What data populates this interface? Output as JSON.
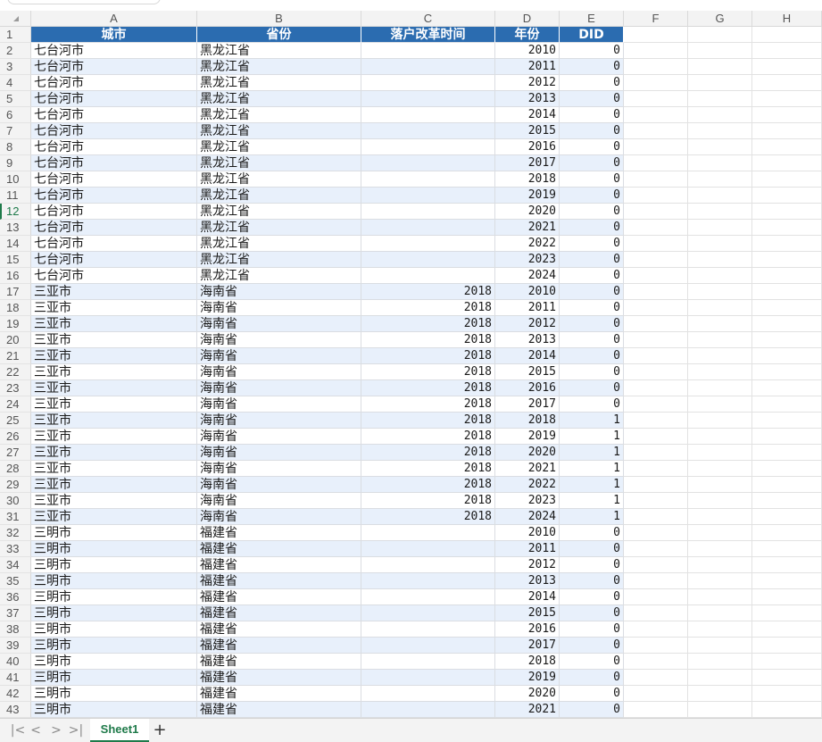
{
  "colors": {
    "header_fill": "#2b6cb0",
    "band_fill": "#e8f0fb",
    "active_accent": "#1f7a4a"
  },
  "column_letters": [
    "A",
    "B",
    "C",
    "D",
    "E",
    "F",
    "G",
    "H"
  ],
  "header_row": [
    "城市",
    "省份",
    "落户改革时间",
    "年份",
    "DID"
  ],
  "rows": [
    {
      "r": 2,
      "city": "七台河市",
      "prov": "黑龙江省",
      "reform": "",
      "year": "2010",
      "did": "0"
    },
    {
      "r": 3,
      "city": "七台河市",
      "prov": "黑龙江省",
      "reform": "",
      "year": "2011",
      "did": "0"
    },
    {
      "r": 4,
      "city": "七台河市",
      "prov": "黑龙江省",
      "reform": "",
      "year": "2012",
      "did": "0"
    },
    {
      "r": 5,
      "city": "七台河市",
      "prov": "黑龙江省",
      "reform": "",
      "year": "2013",
      "did": "0"
    },
    {
      "r": 6,
      "city": "七台河市",
      "prov": "黑龙江省",
      "reform": "",
      "year": "2014",
      "did": "0"
    },
    {
      "r": 7,
      "city": "七台河市",
      "prov": "黑龙江省",
      "reform": "",
      "year": "2015",
      "did": "0"
    },
    {
      "r": 8,
      "city": "七台河市",
      "prov": "黑龙江省",
      "reform": "",
      "year": "2016",
      "did": "0"
    },
    {
      "r": 9,
      "city": "七台河市",
      "prov": "黑龙江省",
      "reform": "",
      "year": "2017",
      "did": "0"
    },
    {
      "r": 10,
      "city": "七台河市",
      "prov": "黑龙江省",
      "reform": "",
      "year": "2018",
      "did": "0"
    },
    {
      "r": 11,
      "city": "七台河市",
      "prov": "黑龙江省",
      "reform": "",
      "year": "2019",
      "did": "0"
    },
    {
      "r": 12,
      "city": "七台河市",
      "prov": "黑龙江省",
      "reform": "",
      "year": "2020",
      "did": "0"
    },
    {
      "r": 13,
      "city": "七台河市",
      "prov": "黑龙江省",
      "reform": "",
      "year": "2021",
      "did": "0"
    },
    {
      "r": 14,
      "city": "七台河市",
      "prov": "黑龙江省",
      "reform": "",
      "year": "2022",
      "did": "0"
    },
    {
      "r": 15,
      "city": "七台河市",
      "prov": "黑龙江省",
      "reform": "",
      "year": "2023",
      "did": "0"
    },
    {
      "r": 16,
      "city": "七台河市",
      "prov": "黑龙江省",
      "reform": "",
      "year": "2024",
      "did": "0"
    },
    {
      "r": 17,
      "city": "三亚市",
      "prov": "海南省",
      "reform": "2018",
      "year": "2010",
      "did": "0"
    },
    {
      "r": 18,
      "city": "三亚市",
      "prov": "海南省",
      "reform": "2018",
      "year": "2011",
      "did": "0"
    },
    {
      "r": 19,
      "city": "三亚市",
      "prov": "海南省",
      "reform": "2018",
      "year": "2012",
      "did": "0"
    },
    {
      "r": 20,
      "city": "三亚市",
      "prov": "海南省",
      "reform": "2018",
      "year": "2013",
      "did": "0"
    },
    {
      "r": 21,
      "city": "三亚市",
      "prov": "海南省",
      "reform": "2018",
      "year": "2014",
      "did": "0"
    },
    {
      "r": 22,
      "city": "三亚市",
      "prov": "海南省",
      "reform": "2018",
      "year": "2015",
      "did": "0"
    },
    {
      "r": 23,
      "city": "三亚市",
      "prov": "海南省",
      "reform": "2018",
      "year": "2016",
      "did": "0"
    },
    {
      "r": 24,
      "city": "三亚市",
      "prov": "海南省",
      "reform": "2018",
      "year": "2017",
      "did": "0"
    },
    {
      "r": 25,
      "city": "三亚市",
      "prov": "海南省",
      "reform": "2018",
      "year": "2018",
      "did": "1"
    },
    {
      "r": 26,
      "city": "三亚市",
      "prov": "海南省",
      "reform": "2018",
      "year": "2019",
      "did": "1"
    },
    {
      "r": 27,
      "city": "三亚市",
      "prov": "海南省",
      "reform": "2018",
      "year": "2020",
      "did": "1"
    },
    {
      "r": 28,
      "city": "三亚市",
      "prov": "海南省",
      "reform": "2018",
      "year": "2021",
      "did": "1"
    },
    {
      "r": 29,
      "city": "三亚市",
      "prov": "海南省",
      "reform": "2018",
      "year": "2022",
      "did": "1"
    },
    {
      "r": 30,
      "city": "三亚市",
      "prov": "海南省",
      "reform": "2018",
      "year": "2023",
      "did": "1"
    },
    {
      "r": 31,
      "city": "三亚市",
      "prov": "海南省",
      "reform": "2018",
      "year": "2024",
      "did": "1"
    },
    {
      "r": 32,
      "city": "三明市",
      "prov": "福建省",
      "reform": "",
      "year": "2010",
      "did": "0"
    },
    {
      "r": 33,
      "city": "三明市",
      "prov": "福建省",
      "reform": "",
      "year": "2011",
      "did": "0"
    },
    {
      "r": 34,
      "city": "三明市",
      "prov": "福建省",
      "reform": "",
      "year": "2012",
      "did": "0"
    },
    {
      "r": 35,
      "city": "三明市",
      "prov": "福建省",
      "reform": "",
      "year": "2013",
      "did": "0"
    },
    {
      "r": 36,
      "city": "三明市",
      "prov": "福建省",
      "reform": "",
      "year": "2014",
      "did": "0"
    },
    {
      "r": 37,
      "city": "三明市",
      "prov": "福建省",
      "reform": "",
      "year": "2015",
      "did": "0"
    },
    {
      "r": 38,
      "city": "三明市",
      "prov": "福建省",
      "reform": "",
      "year": "2016",
      "did": "0"
    },
    {
      "r": 39,
      "city": "三明市",
      "prov": "福建省",
      "reform": "",
      "year": "2017",
      "did": "0"
    },
    {
      "r": 40,
      "city": "三明市",
      "prov": "福建省",
      "reform": "",
      "year": "2018",
      "did": "0"
    },
    {
      "r": 41,
      "city": "三明市",
      "prov": "福建省",
      "reform": "",
      "year": "2019",
      "did": "0"
    },
    {
      "r": 42,
      "city": "三明市",
      "prov": "福建省",
      "reform": "",
      "year": "2020",
      "did": "0"
    },
    {
      "r": 43,
      "city": "三明市",
      "prov": "福建省",
      "reform": "",
      "year": "2021",
      "did": "0"
    }
  ],
  "active_row": 12,
  "tabbar": {
    "nav": [
      "|<",
      "<",
      ">",
      ">|"
    ],
    "sheet_tab": "Sheet1",
    "add_tab": "+"
  }
}
